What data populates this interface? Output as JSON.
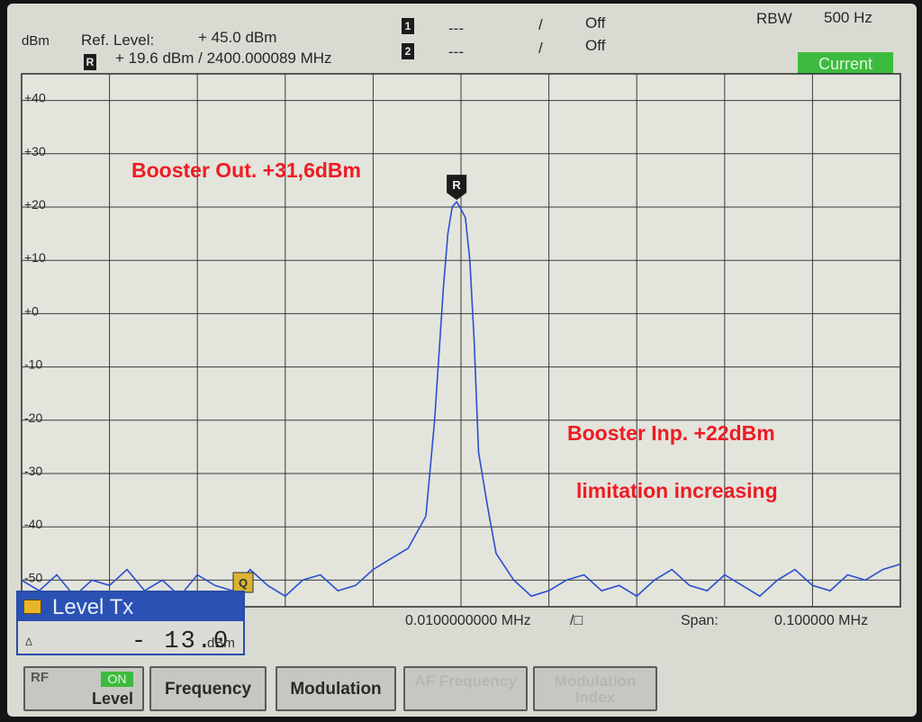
{
  "header": {
    "unit": "dBm",
    "ref_level_label": "Ref. Level:",
    "ref_level_value": "+ 45.0  dBm",
    "ref_marker_glyph": "R",
    "ref_marker_readout": "+ 19.6  dBm /  2400.000089  MHz",
    "marker1_glyph": "1",
    "marker1_readout": "---",
    "marker1_sep": "/",
    "marker1_state": "Off",
    "marker2_glyph": "2",
    "marker2_readout": "---",
    "marker2_sep": "/",
    "marker2_state": "Off",
    "rbw_label": "RBW",
    "rbw_value": "500 Hz",
    "status_badge": "Current"
  },
  "chart_data": {
    "type": "line",
    "y_ticks": [
      "+40",
      "+30",
      "+20",
      "+10",
      "+0",
      "-10",
      "-20",
      "-30",
      "-40",
      "-50"
    ],
    "ylim": [
      -55,
      45
    ],
    "xlim": [
      -0.05,
      0.05
    ],
    "grid": true,
    "center_label": "0.0100000000 MHz",
    "center_suffix": "/□",
    "span_label": "Span:",
    "span_value": "0.100000  MHz",
    "peak_marker": "R",
    "sweep_marker": "Q",
    "series": [
      {
        "color": "#2a4fd0",
        "x": [
          -0.05,
          -0.048,
          -0.046,
          -0.044,
          -0.042,
          -0.04,
          -0.038,
          -0.036,
          -0.034,
          -0.032,
          -0.03,
          -0.028,
          -0.026,
          -0.024,
          -0.022,
          -0.02,
          -0.018,
          -0.016,
          -0.014,
          -0.012,
          -0.01,
          -0.008,
          -0.006,
          -0.004,
          -0.003,
          -0.002,
          -0.0015,
          -0.001,
          -0.0005,
          0,
          0.0005,
          0.001,
          0.0015,
          0.002,
          0.003,
          0.004,
          0.006,
          0.008,
          0.01,
          0.012,
          0.014,
          0.016,
          0.018,
          0.02,
          0.022,
          0.024,
          0.026,
          0.028,
          0.03,
          0.032,
          0.034,
          0.036,
          0.038,
          0.04,
          0.042,
          0.044,
          0.046,
          0.048,
          0.05
        ],
        "y": [
          -50,
          -52,
          -49,
          -53,
          -50,
          -51,
          -48,
          -52,
          -50,
          -53,
          -49,
          -51,
          -52,
          -48,
          -51,
          -53,
          -50,
          -49,
          -52,
          -51,
          -48,
          -46,
          -44,
          -38,
          -20,
          5,
          15,
          20,
          21,
          19.6,
          18,
          10,
          -5,
          -26,
          -36,
          -45,
          -50,
          -53,
          -52,
          -50,
          -49,
          -52,
          -51,
          -53,
          -50,
          -48,
          -51,
          -52,
          -49,
          -51,
          -53,
          -50,
          -48,
          -51,
          -52,
          -49,
          -50,
          -48,
          -47
        ]
      }
    ]
  },
  "annotations": {
    "booster_out": "Booster Out. +31,6dBm",
    "booster_inp": "Booster Inp. +22dBm",
    "limitation": "limitation increasing"
  },
  "level_panel": {
    "title": "Level Tx",
    "delta": "Δ",
    "value": "- 13.0",
    "unit": "dBm"
  },
  "softkeys": {
    "rf_title": "RF",
    "rf_state": "ON",
    "rf_level": "Level",
    "frequency": "Frequency",
    "modulation": "Modulation",
    "af_frequency": "AF Frequency",
    "modulation_index": "Modulation Index"
  }
}
